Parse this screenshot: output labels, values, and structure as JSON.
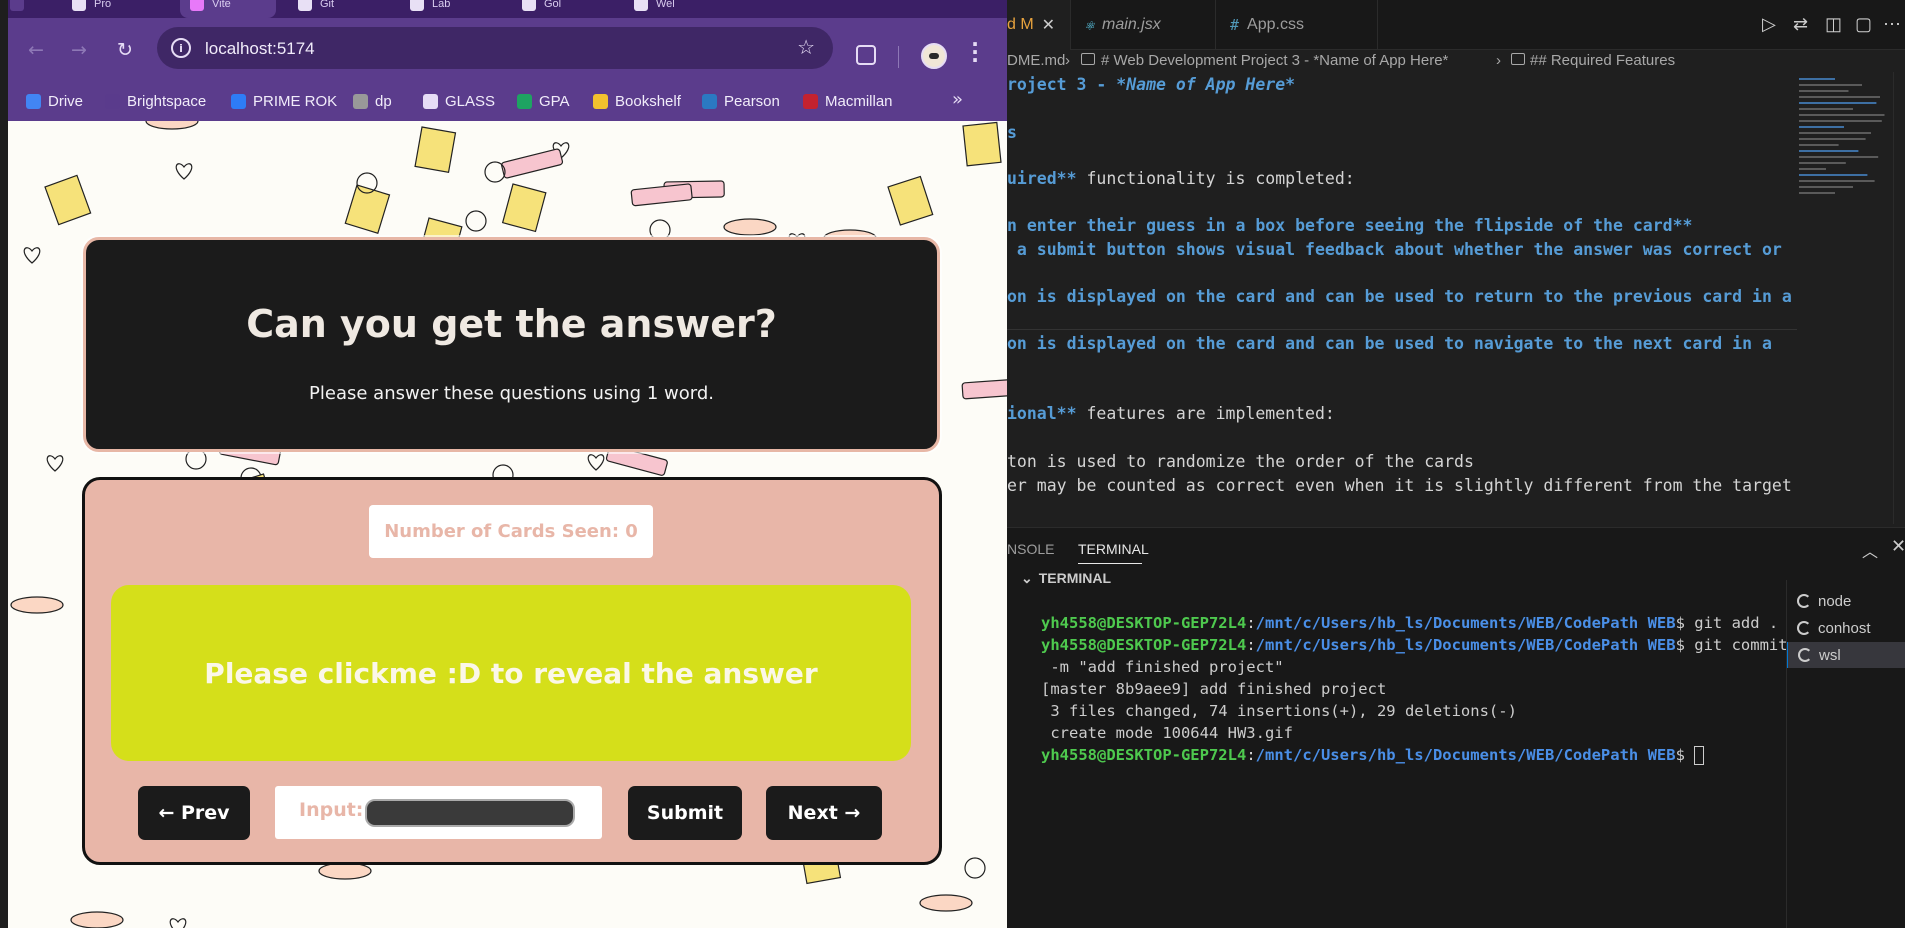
{
  "browser": {
    "tabs": [
      {
        "label": "Pro"
      },
      {
        "label": "Vite"
      },
      {
        "label": "Git"
      },
      {
        "label": "Lab"
      },
      {
        "label": "Gol"
      },
      {
        "label": "Wel"
      }
    ],
    "url": "localhost:5174",
    "bookmarks": [
      {
        "label": "Drive",
        "icon": "drive-icon",
        "color": "#4285f4"
      },
      {
        "label": "Brightspace",
        "icon": "brightspace-icon",
        "color": "#5a3b8c"
      },
      {
        "label": "PRIME ROK",
        "icon": "prime-rok-icon",
        "color": "#2e7cf6"
      },
      {
        "label": "dp",
        "icon": "dp-icon",
        "color": "#999999"
      },
      {
        "label": "GLASS",
        "icon": "folder-icon",
        "color": "#e6dcf5"
      },
      {
        "label": "GPA",
        "icon": "sheets-icon",
        "color": "#1ea362"
      },
      {
        "label": "Bookshelf",
        "icon": "bookshelf-icon",
        "color": "#f2c12e"
      },
      {
        "label": "Pearson",
        "icon": "pearson-icon",
        "color": "#2b79c2"
      },
      {
        "label": "Macmillan",
        "icon": "macmillan-icon",
        "color": "#c4222f"
      }
    ],
    "bookmarks_more": "»"
  },
  "app": {
    "title": "Can you get the answer?",
    "subtitle": "Please answer these questions using 1 word.",
    "cards_seen": "Number of Cards Seen: 0",
    "card_text": "Please clickme :D to reveal the answer",
    "prev_label": "← Prev",
    "input_label": "Input:",
    "input_value": "",
    "submit_label": "Submit",
    "next_label": "Next →",
    "colors": {
      "card_bg": "#e8b6a8",
      "flashcard": "#d5df1a",
      "header": "#1b1b1b"
    }
  },
  "vscode": {
    "tabs": [
      {
        "label": "d M",
        "icon": "markdown-icon"
      },
      {
        "label": "main.jsx",
        "icon": "react-icon"
      },
      {
        "label": "App.css",
        "icon": "css-icon"
      }
    ],
    "breadcrumb": {
      "file": "DME.md",
      "section1": "# Web Development Project 3 - *Name of App Here*",
      "section2": "## Required Features"
    },
    "editor_lines": [
      {
        "a": "roject 3 - ",
        "b": "*Name of App Here*"
      },
      {
        "a": "s"
      },
      {
        "a": "uired**",
        "b": " functionality is completed:"
      },
      {
        "a": "n enter their guess in a box before seeing the flipside of the card**"
      },
      {
        "a": " a submit button shows visual feedback about whether the answer was correct or"
      },
      {
        "a": "on is displayed on the card and can be used to return to the previous card in a"
      },
      {
        "a": "on is displayed on the card and can be used to navigate to the next card in a"
      },
      {
        "a": "ional**",
        "b": " features are implemented:"
      },
      {
        "a": "ton is used to randomize the order of the cards"
      },
      {
        "a": "er may be counted as correct even when it is slightly different from the target"
      }
    ],
    "panel_tabs": {
      "console": "NSOLE",
      "terminal": "TERMINAL"
    },
    "terminal_header": "TERMINAL",
    "terminal": {
      "user": "yh4558@DESKTOP-GEP72L4",
      "path": "/mnt/c/Users/hb_ls/Documents/WEB/CodePath WEB",
      "cmd1": "$ git add .",
      "cmd2": "$ git commit",
      "cmd2b": " -m \"add finished project\"",
      "out1": "[master 8b9aee9] add finished project",
      "out2": " 3 files changed, 74 insertions(+), 29 deletions(-)",
      "out3": " create mode 100644 HW3.gif",
      "prompt": "$ "
    },
    "terminal_list": [
      {
        "label": "node"
      },
      {
        "label": "conhost"
      },
      {
        "label": "wsl"
      }
    ]
  }
}
